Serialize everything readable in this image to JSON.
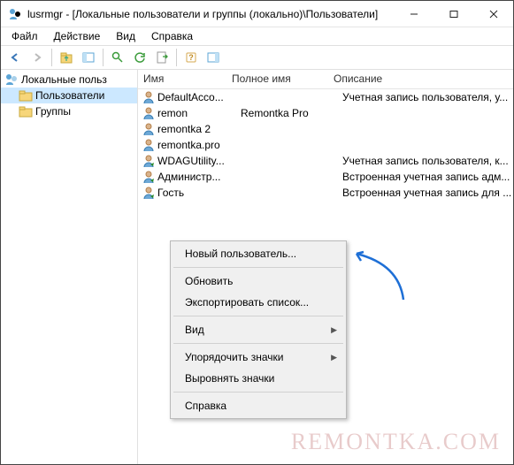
{
  "title": "lusrmgr - [Локальные пользователи и группы (локально)\\Пользователи]",
  "menus": {
    "file": "Файл",
    "action": "Действие",
    "view": "Вид",
    "help": "Справка"
  },
  "tree": {
    "root": "Локальные польз",
    "children": {
      "users": "Пользователи",
      "groups": "Группы"
    }
  },
  "columns": {
    "name": "Имя",
    "fullname": "Полное имя",
    "description": "Описание"
  },
  "users": [
    {
      "name": "DefaultAcco...",
      "fullname": "",
      "description": "Учетная запись пользователя, у..."
    },
    {
      "name": "remon",
      "fullname": "Remontka Pro",
      "description": ""
    },
    {
      "name": "remontka 2",
      "fullname": "",
      "description": ""
    },
    {
      "name": "remontka.pro",
      "fullname": "",
      "description": ""
    },
    {
      "name": "WDAGUtility...",
      "fullname": "",
      "description": "Учетная запись пользователя, к..."
    },
    {
      "name": "Администр...",
      "fullname": "",
      "description": "Встроенная учетная запись адм..."
    },
    {
      "name": "Гость",
      "fullname": "",
      "description": "Встроенная учетная запись для ..."
    }
  ],
  "context_menu": {
    "new_user": "Новый пользователь...",
    "refresh": "Обновить",
    "export_list": "Экспортировать список...",
    "view": "Вид",
    "arrange_icons": "Упорядочить значки",
    "align_icons": "Выровнять значки",
    "help": "Справка"
  },
  "watermark": "REMONTKA.COM"
}
